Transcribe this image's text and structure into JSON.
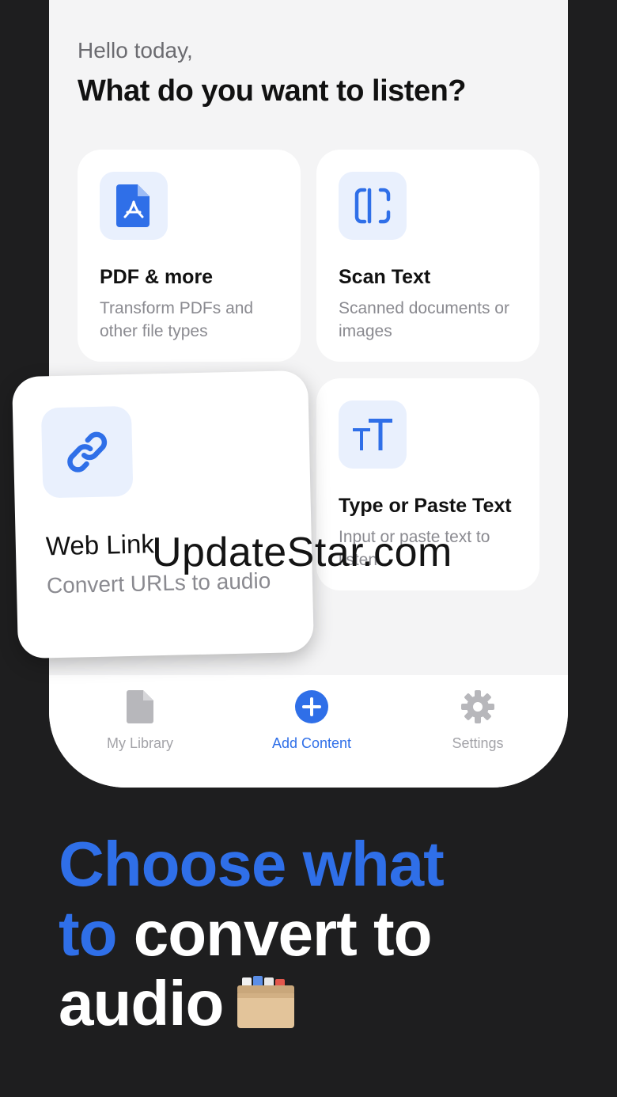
{
  "greeting": "Hello today,",
  "headline": "What do you want to listen?",
  "cards": {
    "pdf": {
      "title": "PDF & more",
      "desc": "Transform PDFs and other file types",
      "icon": "pdf-file-icon"
    },
    "scan": {
      "title": "Scan Text",
      "desc": "Scanned documents or images",
      "icon": "scan-icon"
    },
    "type": {
      "title": "Type or Paste Text",
      "desc": "Input or paste text to listen",
      "icon": "text-size-icon"
    },
    "web": {
      "title": "Web Link",
      "desc": "Convert URLs to audio",
      "icon": "link-icon"
    }
  },
  "tabs": {
    "library": "My Library",
    "add": "Add Content",
    "settings": "Settings"
  },
  "watermark": "UpdateStar.com",
  "caption": {
    "line1": "Choose what",
    "line2_blue": "to",
    "line2_white": "convert to",
    "line3": "audio"
  },
  "colors": {
    "accent": "#2f6fe8",
    "background": "#1e1e1f",
    "icon_tile": "#e9f0fd"
  }
}
